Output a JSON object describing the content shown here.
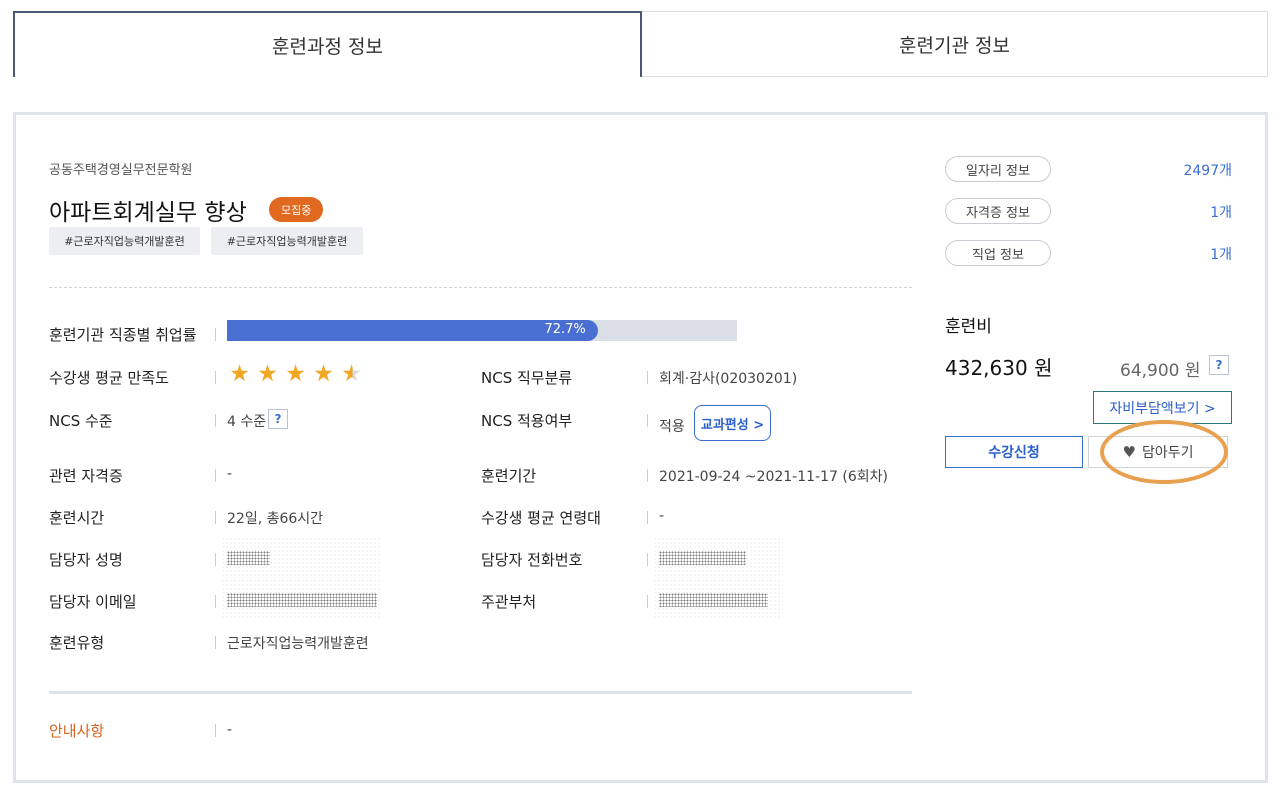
{
  "tabs": [
    {
      "label": "훈련과정 정보"
    },
    {
      "label": "훈련기관 정보"
    }
  ],
  "course": {
    "institute": "공동주택경영실무전문학원",
    "title": "아파트회계실무 향상",
    "status_badge": "모집중",
    "tags": [
      "#근로자직업능력개발훈련",
      "#근로자직업능력개발훈련"
    ]
  },
  "details": {
    "employment_rate_label": "훈련기관 직종별 취업률",
    "employment_rate_value": "72.7%",
    "employment_rate_fraction": 0.727,
    "satisfaction_label": "수강생 평균 만족도",
    "satisfaction_stars": 4.5,
    "ncs_category_label": "NCS 직무분류",
    "ncs_category_value": "회계·감사(02030201)",
    "ncs_level_label": "NCS 수준",
    "ncs_level_value": "4 수준",
    "ncs_applied_label": "NCS 적용여부",
    "ncs_applied_value": "적용",
    "curriculum_button": "교과편성 >",
    "related_cert_label": "관련 자격증",
    "related_cert_value": "-",
    "period_label": "훈련기간",
    "period_value": "2021-09-24 ~2021-11-17 (6회차)",
    "hours_label": "훈련시간",
    "hours_value": "22일, 총66시간",
    "age_label": "수강생 평균 연령대",
    "age_value": "-",
    "manager_name_label": "담당자 성명",
    "manager_phone_label": "담당자 전화번호",
    "manager_email_label": "담당자 이메일",
    "department_label": "주관부처",
    "type_label": "훈련유형",
    "type_value": "근로자직업능력개발훈련",
    "notice_label": "안내사항",
    "notice_value": "-"
  },
  "sidebar": {
    "links": [
      {
        "label": "일자리 정보",
        "count": "2497개"
      },
      {
        "label": "자격증 정보",
        "count": "1개"
      },
      {
        "label": "직업 정보",
        "count": "1개"
      }
    ],
    "fee_label": "훈련비",
    "fee_amount": "432,630 원",
    "self_pay_amount": "64,900 원",
    "help_mark": "?",
    "self_pay_button": "자비부담액보기 >",
    "apply_button": "수강신청",
    "wishlist_button": "담아두기"
  },
  "colors": {
    "accent_blue": "#3a6fd0",
    "bar_fill": "#4a6fd3",
    "badge_orange": "#e0691f",
    "highlight_ring": "#e8a050",
    "star": "#f1a724"
  }
}
